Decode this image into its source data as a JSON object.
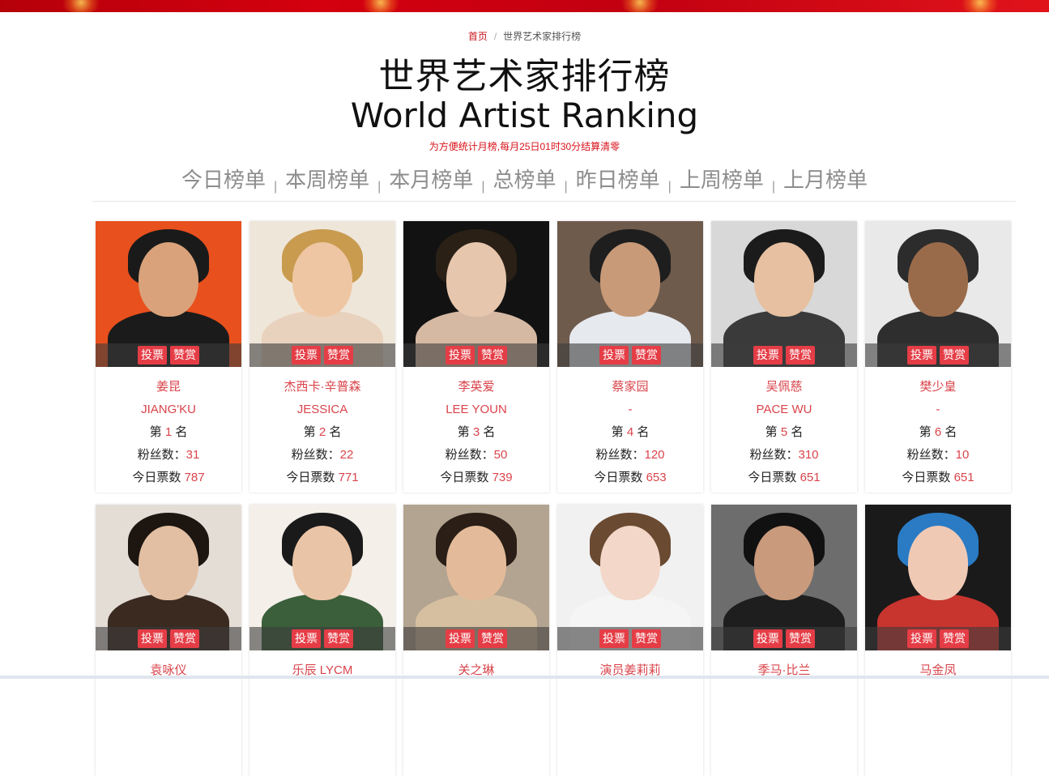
{
  "breadcrumb": {
    "home": "首页",
    "separator": "/",
    "current": "世界艺术家排行榜"
  },
  "title_cn": "世界艺术家排行榜",
  "title_en": "World Artist Ranking",
  "notice": "为方便统计月榜,每月25日01时30分结算清零",
  "tabs": [
    {
      "label": "今日榜单"
    },
    {
      "label": "本周榜单"
    },
    {
      "label": "本月榜单"
    },
    {
      "label": "总榜单"
    },
    {
      "label": "昨日榜单"
    },
    {
      "label": "上周榜单"
    },
    {
      "label": "上月榜单"
    }
  ],
  "tab_separator": "|",
  "labels": {
    "vote": "投票",
    "reward": "赞赏",
    "rank_prefix": "第",
    "rank_suffix": "名",
    "fans": "粉丝数：",
    "today_votes": "今日票数"
  },
  "artists": [
    {
      "name_cn": "姜昆",
      "name_en": "JIANG'KU",
      "rank": "1",
      "fans": "31",
      "votes": "787",
      "colors": {
        "bg": "#e8501d",
        "hair": "#1a1a1a",
        "face": "#d9a27a",
        "body": "#1b1b1b"
      }
    },
    {
      "name_cn": "杰西卡·辛普森",
      "name_en": "JESSICA",
      "rank": "2",
      "fans": "22",
      "votes": "771",
      "colors": {
        "bg": "#efe6da",
        "hair": "#c89b4f",
        "face": "#efc6a3",
        "body": "#e8d2bd"
      }
    },
    {
      "name_cn": "李英爱",
      "name_en": "LEE YOUN",
      "rank": "3",
      "fans": "50",
      "votes": "739",
      "colors": {
        "bg": "#121212",
        "hair": "#2a2016",
        "face": "#e6c6ad",
        "body": "#d6b9a3"
      }
    },
    {
      "name_cn": "蔡家园",
      "name_en": "-",
      "rank": "4",
      "fans": "120",
      "votes": "653",
      "colors": {
        "bg": "#6e5b4c",
        "hair": "#1e1e1e",
        "face": "#c89a78",
        "body": "#e6e9ee"
      }
    },
    {
      "name_cn": "吴佩慈",
      "name_en": "PACE WU",
      "rank": "5",
      "fans": "310",
      "votes": "651",
      "colors": {
        "bg": "#d8d8d8",
        "hair": "#1b1b1b",
        "face": "#e6c0a0",
        "body": "#3a3a3a"
      }
    },
    {
      "name_cn": "樊少皇",
      "name_en": "-",
      "rank": "6",
      "fans": "10",
      "votes": "651",
      "colors": {
        "bg": "#e9e9e9",
        "hair": "#2c2c2c",
        "face": "#9a6b4a",
        "body": "#2e2e2e"
      }
    },
    {
      "name_cn": "袁咏仪",
      "name_en": "",
      "rank": "",
      "fans": "",
      "votes": "",
      "colors": {
        "bg": "#e3ddd6",
        "hair": "#1c1510",
        "face": "#e2bfa2",
        "body": "#3a2a20"
      }
    },
    {
      "name_cn": "乐辰 LYCM",
      "name_en": "",
      "rank": "",
      "fans": "",
      "votes": "",
      "colors": {
        "bg": "#f4efe9",
        "hair": "#1a1a1a",
        "face": "#eac4a6",
        "body": "#3b5f3a"
      }
    },
    {
      "name_cn": "关之琳",
      "name_en": "",
      "rank": "",
      "fans": "",
      "votes": "",
      "colors": {
        "bg": "#b3a491",
        "hair": "#2a1e16",
        "face": "#e3bb9a",
        "body": "#d6bfa0"
      }
    },
    {
      "name_cn": "演员姜莉莉",
      "name_en": "",
      "rank": "",
      "fans": "",
      "votes": "",
      "colors": {
        "bg": "#f1f1f1",
        "hair": "#6b4a32",
        "face": "#f3d7c8",
        "body": "#f5f5f5"
      }
    },
    {
      "name_cn": "季马·比兰",
      "name_en": "",
      "rank": "",
      "fans": "",
      "votes": "",
      "colors": {
        "bg": "#6d6d6d",
        "hair": "#111111",
        "face": "#c99a7c",
        "body": "#1e1e1e"
      }
    },
    {
      "name_cn": "马金凤",
      "name_en": "",
      "rank": "",
      "fans": "",
      "votes": "",
      "colors": {
        "bg": "#1a1a1a",
        "hair": "#2a7bc4",
        "face": "#f0c9b5",
        "body": "#c8342e"
      }
    }
  ]
}
